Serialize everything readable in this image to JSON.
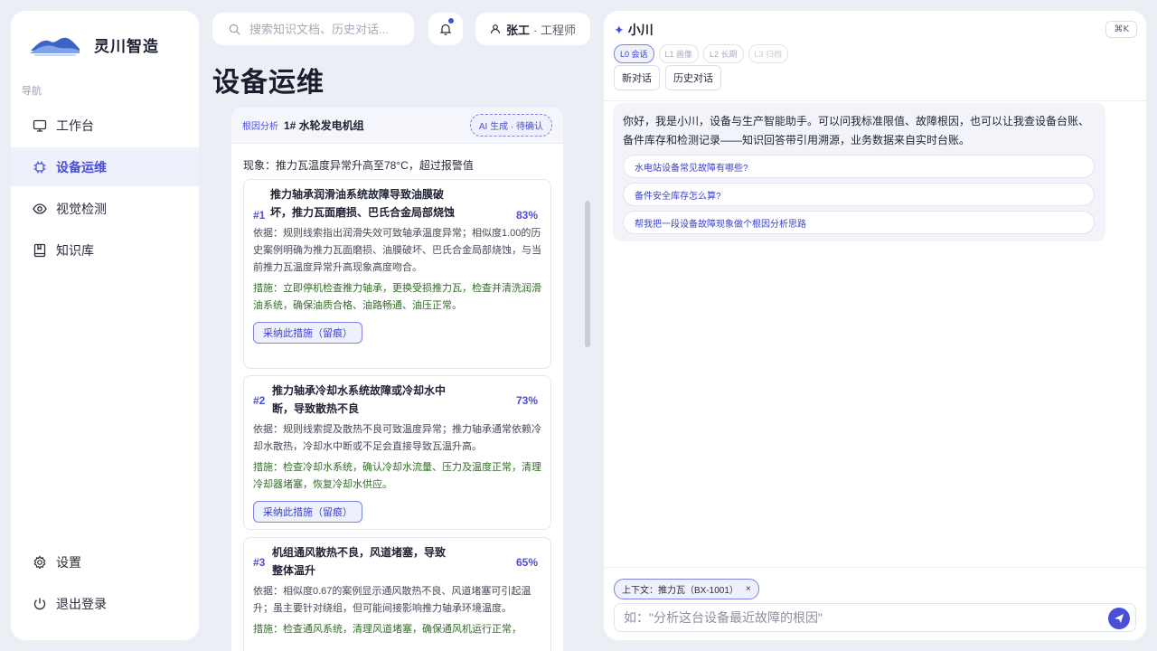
{
  "sidebar": {
    "brand": "灵川智造",
    "nav_caption": "导航",
    "items": [
      {
        "label": "工作台",
        "icon": "monitor-icon"
      },
      {
        "label": "设备运维",
        "icon": "chip-icon",
        "active": true
      },
      {
        "label": "视觉检测",
        "icon": "eye-icon"
      },
      {
        "label": "知识库",
        "icon": "book-icon"
      }
    ],
    "bottom": [
      {
        "label": "设置",
        "icon": "gear-icon"
      },
      {
        "label": "退出登录",
        "icon": "power-icon"
      }
    ]
  },
  "topbar": {
    "search_placeholder": "搜索知识文档、历史对话...",
    "user_name": "张工",
    "user_role": "· 工程师"
  },
  "page": {
    "title": "设备运维"
  },
  "root_cause": {
    "tag": "根因分析",
    "device": "1# 水轮发电机组",
    "ai_badge": "AI 生成 · 待确认",
    "symptom": "现象：推力瓦温度异常升高至78°C，超过报警值",
    "causes": [
      {
        "num": "#1",
        "title": "推力轴承润滑油系统故障导致油膜破坏，推力瓦面磨损、巴氏合金局部烧蚀",
        "pct": "83%",
        "basis": "依据：规则线索指出润滑失效可致轴承温度异常；相似度1.00的历史案例明确为推力瓦面磨损、油膜破坏、巴氏合金局部烧蚀，与当前推力瓦温度异常升高现象高度吻合。",
        "action": "措施：立即停机检查推力轴承，更换受损推力瓦，检查并清洗润滑油系统，确保油质合格、油路畅通、油压正常。",
        "adopt": "采纳此措施（留痕）"
      },
      {
        "num": "#2",
        "title": "推力轴承冷却水系统故障或冷却水中断，导致散热不良",
        "pct": "73%",
        "basis": "依据：规则线索提及散热不良可致温度异常；推力轴承通常依赖冷却水散热，冷却水中断或不足会直接导致瓦温升高。",
        "action": "措施：检查冷却水系统，确认冷却水流量、压力及温度正常，清理冷却器堵塞，恢复冷却水供应。",
        "adopt": "采纳此措施（留痕）"
      },
      {
        "num": "#3",
        "title": "机组通风散热不良，风道堵塞，导致整体温升",
        "pct": "65%",
        "basis": "依据：相似度0.67的案例显示通风散热不良、风道堵塞可引起温升；虽主要针对绕组，但可能间接影响推力轴承环境温度。",
        "action": "措施：检查通风系统，清理风道堵塞，确保通风机运行正常，"
      }
    ]
  },
  "chat": {
    "name": "小川",
    "shortcut": "⌘K",
    "levels": [
      "L0 会话",
      "L1 画像",
      "L2 长期",
      "L3 归档"
    ],
    "new_chat": "新对话",
    "history": "历史对话",
    "greeting": "你好，我是小川，设备与生产智能助手。可以问我标准限值、故障根因，也可以让我查设备台账、备件库存和检测记录——知识回答带引用溯源，业务数据来自实时台账。",
    "suggestions": [
      "水电站设备常见故障有哪些?",
      "备件安全库存怎么算?",
      "帮我把一段设备故障现象做个根因分析思路"
    ],
    "context_chip": "上下文：推力瓦（BX-1001）",
    "context_close": "×",
    "input_placeholder": "如：\"分析这台设备最近故障的根因\""
  }
}
